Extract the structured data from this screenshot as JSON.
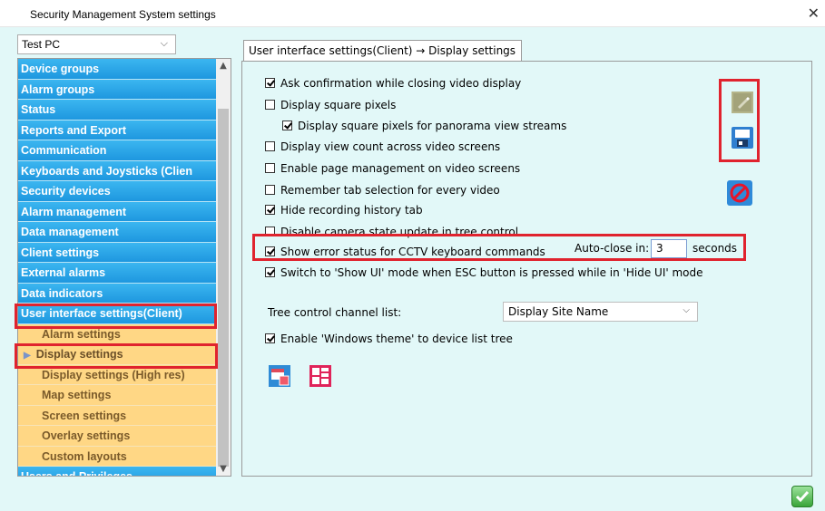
{
  "window": {
    "title": "Security Management System settings",
    "close_glyph": "✕"
  },
  "pc_select": {
    "value": "Test PC"
  },
  "nav": {
    "items": [
      {
        "label": "Device groups",
        "kind": "blue"
      },
      {
        "label": "Alarm groups",
        "kind": "blue"
      },
      {
        "label": "Status",
        "kind": "blue"
      },
      {
        "label": "Reports and Export",
        "kind": "blue"
      },
      {
        "label": "Communication",
        "kind": "blue"
      },
      {
        "label": "Keyboards and Joysticks (Clien",
        "kind": "blue"
      },
      {
        "label": "Security devices",
        "kind": "blue"
      },
      {
        "label": "Alarm management",
        "kind": "blue"
      },
      {
        "label": "Data management",
        "kind": "blue"
      },
      {
        "label": "Client settings",
        "kind": "blue"
      },
      {
        "label": "External alarms",
        "kind": "blue"
      },
      {
        "label": "Data indicators",
        "kind": "blue"
      },
      {
        "label": "User interface settings(Client)",
        "kind": "blue"
      },
      {
        "label": "Alarm settings",
        "kind": "sub"
      },
      {
        "label": "Display settings",
        "kind": "sub",
        "selected": true
      },
      {
        "label": "Display settings (High res)",
        "kind": "sub"
      },
      {
        "label": "Map settings",
        "kind": "sub"
      },
      {
        "label": "Screen settings",
        "kind": "sub"
      },
      {
        "label": "Overlay settings",
        "kind": "sub"
      },
      {
        "label": "Custom layouts",
        "kind": "sub"
      },
      {
        "label": "Users and Privileges",
        "kind": "blue"
      }
    ]
  },
  "tab": {
    "label": "User interface settings(Client) → Display settings"
  },
  "options": [
    {
      "label": "Ask confirmation while closing video display",
      "checked": true
    },
    {
      "label": "Display square pixels",
      "checked": false
    },
    {
      "label": "Display square pixels for panorama view streams",
      "checked": true,
      "indent": true
    },
    {
      "label": "Display view count across video screens",
      "checked": false
    },
    {
      "label": "Enable page management on video screens",
      "checked": false
    },
    {
      "label": "Remember tab selection for every video",
      "checked": false
    },
    {
      "label": "Hide recording history tab",
      "checked": true
    },
    {
      "label": "Disable camera state update in tree control",
      "checked": false
    },
    {
      "label": "Show error status for CCTV keyboard commands",
      "checked": true
    },
    {
      "label": "Switch to 'Show UI' mode when ESC button is pressed while in 'Hide UI' mode",
      "checked": true
    }
  ],
  "autoclose": {
    "label": "Auto-close in:",
    "value": "3",
    "unit": "seconds"
  },
  "tree_control": {
    "label": "Tree control channel list:",
    "value": "Display Site Name"
  },
  "enable_windows_theme": {
    "label": "Enable 'Windows theme' to device list tree",
    "checked": true
  },
  "colors": {
    "nav_blue": "#1e97df",
    "nav_sub": "#ffd785",
    "highlight_red": "#e0232e",
    "panel_bg": "#e2f8f8"
  },
  "icons": [
    "edit-icon",
    "save-icon",
    "cancel-icon",
    "import-layout-icon",
    "grid-layout-icon",
    "ok-check-icon"
  ]
}
